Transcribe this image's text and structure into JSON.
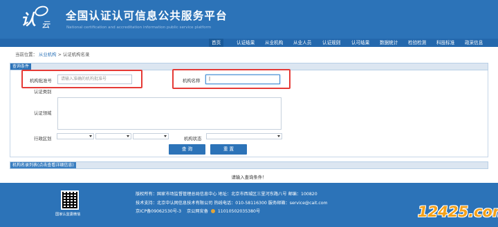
{
  "header": {
    "logo_text_main": "认",
    "logo_text_sub": "云",
    "title": "全国认证认可信息公共服务平台",
    "subtitle": "National certification and accreditation information public service platform"
  },
  "nav": {
    "items": [
      "首页",
      "认证结果",
      "从业机构",
      "从业人员",
      "认证规则",
      "认可结果",
      "数据统计",
      "检验检测",
      "科技标准",
      "政采信息"
    ],
    "active_index": 0
  },
  "breadcrumb": {
    "prefix": "当前位置：",
    "level1": "从业机构",
    "separator": ">",
    "level2": "认证机构名录"
  },
  "search_panel": {
    "title": "查询条件",
    "approval_no_label": "机构批准号",
    "approval_no_placeholder": "请输入准确的机构批准号",
    "org_name_label": "机构名称",
    "org_name_value": "|",
    "cert_type_label": "认证类别",
    "cert_field_label": "认证领域",
    "region_label": "行政区划",
    "status_label": "机构状态",
    "query_button": "查 询",
    "reset_button": "重 置"
  },
  "result_panel": {
    "title": "机构名录列表(点击查看详细信息)",
    "message": "请输入查询条件！"
  },
  "footer": {
    "qr_label": "国家认监委微信",
    "line1": "版权所有：国家市场监督管理总局信息中心    地址：北京市西城区三里河东路八号    邮编：100820",
    "line2": "技术支持：北京中认网信息技术有限公司    热线电话：010-58116300    服务邮箱：service@cait.com",
    "icp": "京ICP备09062530号-3",
    "police_prefix": "京公网安备",
    "police_no": "11010502035380号"
  },
  "watermark": "12425.com"
}
